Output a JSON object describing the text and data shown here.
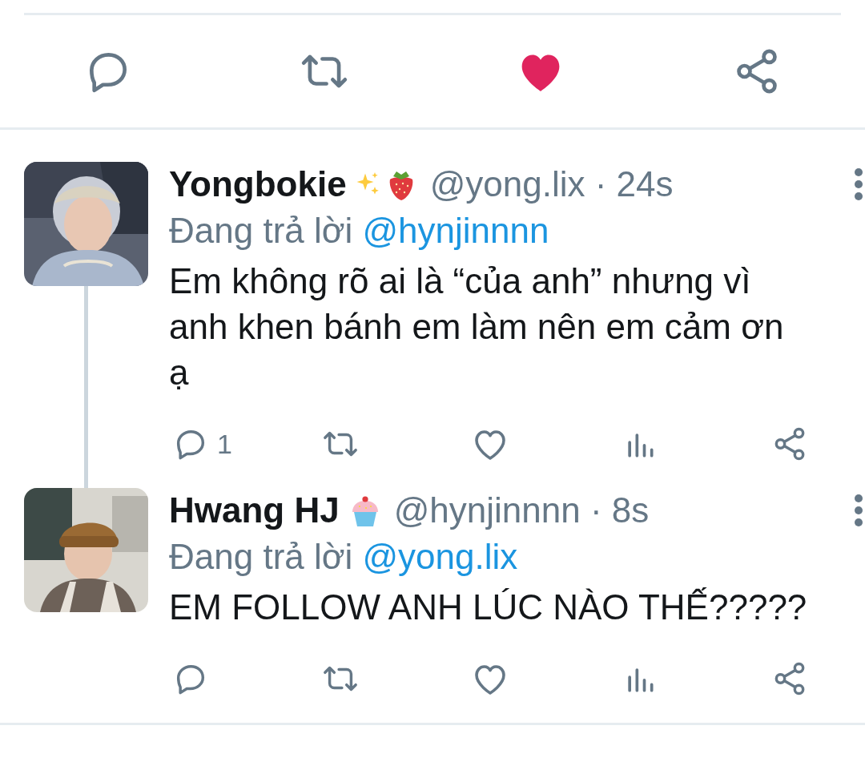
{
  "main_actions": {
    "liked": true
  },
  "tweets": [
    {
      "name": "Yongbokie",
      "badges": [
        {
          "kind": "sparkles"
        },
        {
          "kind": "strawberry"
        }
      ],
      "meta": "@yong.lix · 24s",
      "reply_prefix": "Đang trả lời",
      "reply_to": "@hynjinnnn",
      "text": "Em không rõ ai là “của anh” nhưng vì anh khen bánh em làm nên em cảm ơn ạ",
      "reply_count": "1",
      "liked": false,
      "thread_continues": true
    },
    {
      "name": "Hwang HJ",
      "badges": [
        {
          "kind": "cupcake"
        }
      ],
      "meta": "@hynjinnnn · 8s",
      "reply_prefix": "Đang trả lời",
      "reply_to": "@yong.lix",
      "text": "EM FOLLOW ANH LÚC NÀO THẾ?????",
      "liked": false,
      "thread_continues": false
    }
  ]
}
